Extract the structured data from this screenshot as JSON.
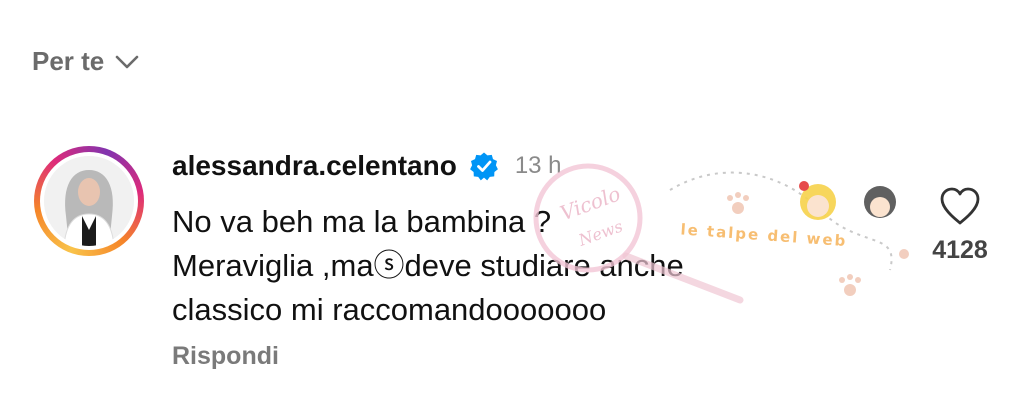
{
  "sort": {
    "label": "Per te",
    "icon": "chevron-down-icon"
  },
  "comment": {
    "username": "alessandra.celentano",
    "verified_icon": "verified-badge-icon",
    "time": "13 h",
    "lines": [
      "No va beh ma la bambina ?",
      "Meraviglia ,maⓢdeve studiare anche",
      "classico mi raccomandooooooo"
    ],
    "reply_label": "Rispondi",
    "like_icon": "heart-icon",
    "like_count": "4128"
  },
  "watermark": {
    "text": "le talpe del web",
    "brand": "Vicolo delle News"
  },
  "colors": {
    "verified": "#0095f6",
    "muted": "#8a8a8a",
    "text": "#111111"
  }
}
